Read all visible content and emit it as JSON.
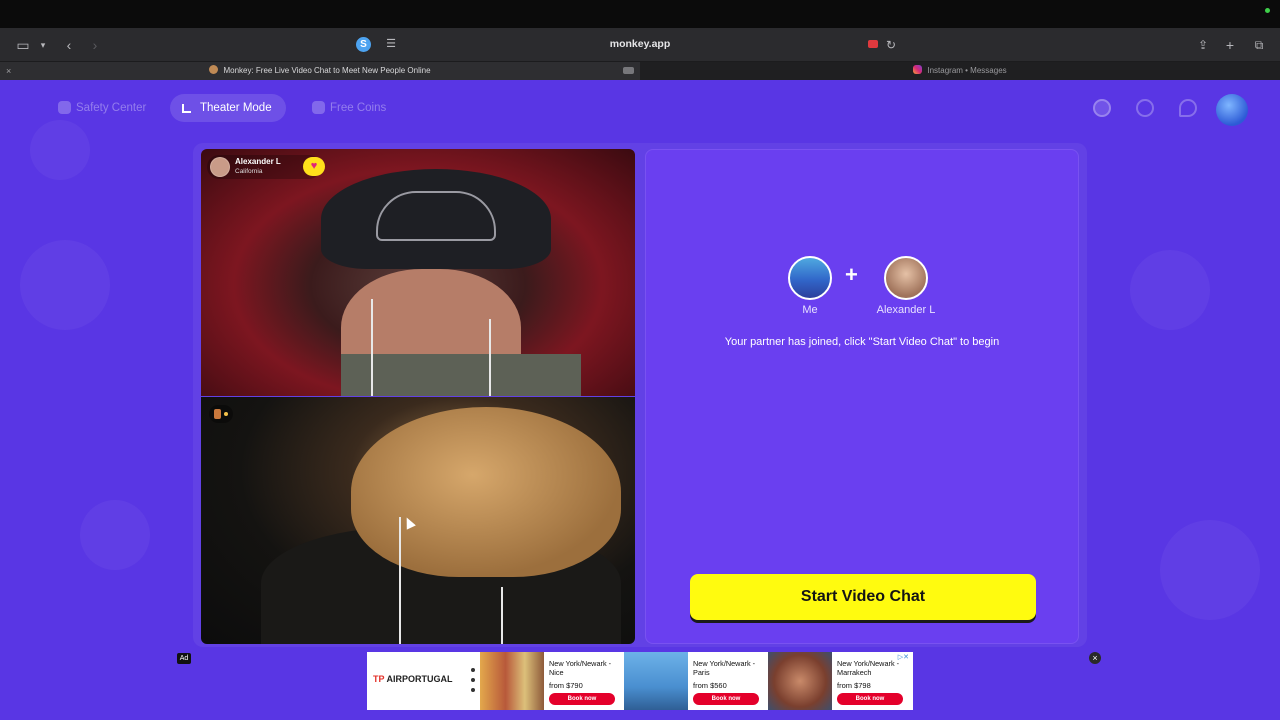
{
  "browser": {
    "url": "monkey.app",
    "profile_badge": "S",
    "tabs": [
      {
        "title": "Monkey: Free Live Video Chat to Meet New People Online",
        "active": true
      },
      {
        "title": "Instagram • Messages",
        "active": false
      }
    ],
    "tab_close": "×"
  },
  "nav": {
    "safety_center": "Safety Center",
    "theater_mode": "Theater Mode",
    "free_coins": "Free Coins"
  },
  "partner": {
    "name": "Alexander L",
    "location": "California",
    "heart": "♥"
  },
  "panel": {
    "me_label": "Me",
    "plus": "+",
    "partner_label": "Alexander L",
    "message": "Your partner has joined, click \"Start Video Chat\" to begin",
    "start_button": "Start Video Chat"
  },
  "ad": {
    "tag": "Ad",
    "close": "×",
    "brand_mark": "TP",
    "brand": "AIRPORTUGAL",
    "adchoices": "▷✕",
    "offers": [
      {
        "destination": "New York/Newark - Nice",
        "price": "from $790",
        "cta": "Book now"
      },
      {
        "destination": "New York/Newark - Paris",
        "price": "from $560",
        "cta": "Book now"
      },
      {
        "destination": "New York/Newark - Marrakech",
        "price": "from $798",
        "cta": "Book now"
      }
    ]
  },
  "colors": {
    "page_bg": "#5936e4",
    "panel_bg": "#6a3ff0",
    "start_button": "#fffb0f",
    "book_now": "#e4002b"
  }
}
